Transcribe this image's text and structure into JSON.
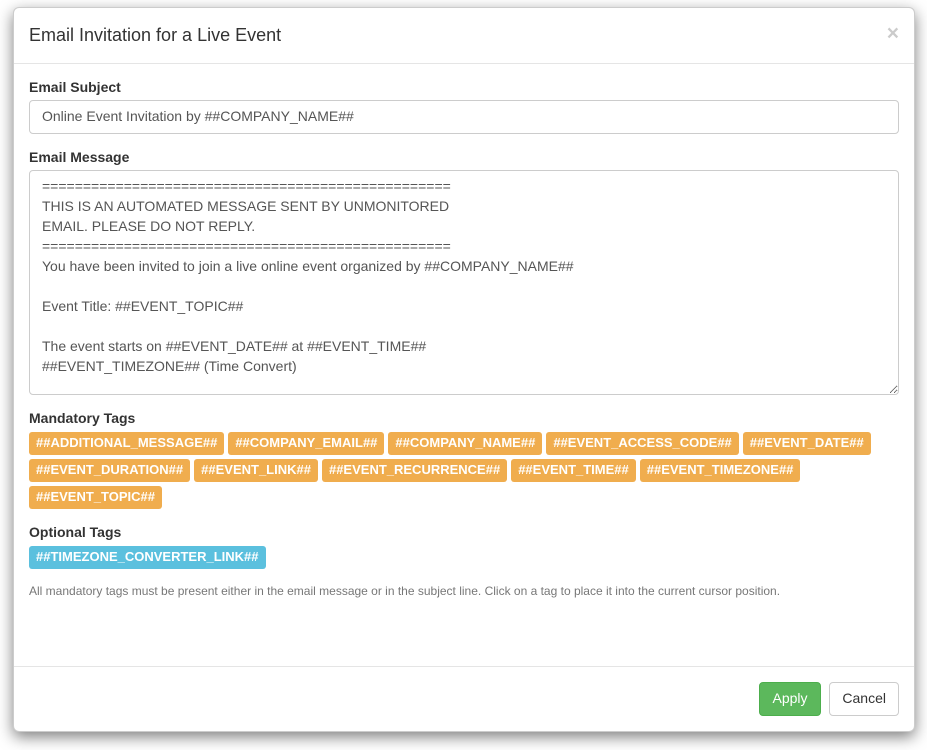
{
  "modal": {
    "title": "Email Invitation for a Live Event",
    "close_symbol": "×"
  },
  "subject": {
    "label": "Email Subject",
    "value": "Online Event Invitation by ##COMPANY_NAME##"
  },
  "message": {
    "label": "Email Message",
    "value": "==================================================\nTHIS IS AN AUTOMATED MESSAGE SENT BY UNMONITORED\nEMAIL. PLEASE DO NOT REPLY.\n==================================================\nYou have been invited to join a live online event organized by ##COMPANY_NAME##\n\nEvent Title: ##EVENT_TOPIC##\n\nThe event starts on ##EVENT_DATE## at ##EVENT_TIME##\n##EVENT_TIMEZONE## (Time Convert)"
  },
  "mandatoryTags": {
    "label": "Mandatory Tags",
    "items": [
      "##ADDITIONAL_MESSAGE##",
      "##COMPANY_EMAIL##",
      "##COMPANY_NAME##",
      "##EVENT_ACCESS_CODE##",
      "##EVENT_DATE##",
      "##EVENT_DURATION##",
      "##EVENT_LINK##",
      "##EVENT_RECURRENCE##",
      "##EVENT_TIME##",
      "##EVENT_TIMEZONE##",
      "##EVENT_TOPIC##"
    ]
  },
  "optionalTags": {
    "label": "Optional Tags",
    "items": [
      "##TIMEZONE_CONVERTER_LINK##"
    ]
  },
  "helpText": "All mandatory tags must be present either in the email message or in the subject line. Click on a tag to place it into the current cursor position.",
  "footer": {
    "apply": "Apply",
    "cancel": "Cancel"
  }
}
